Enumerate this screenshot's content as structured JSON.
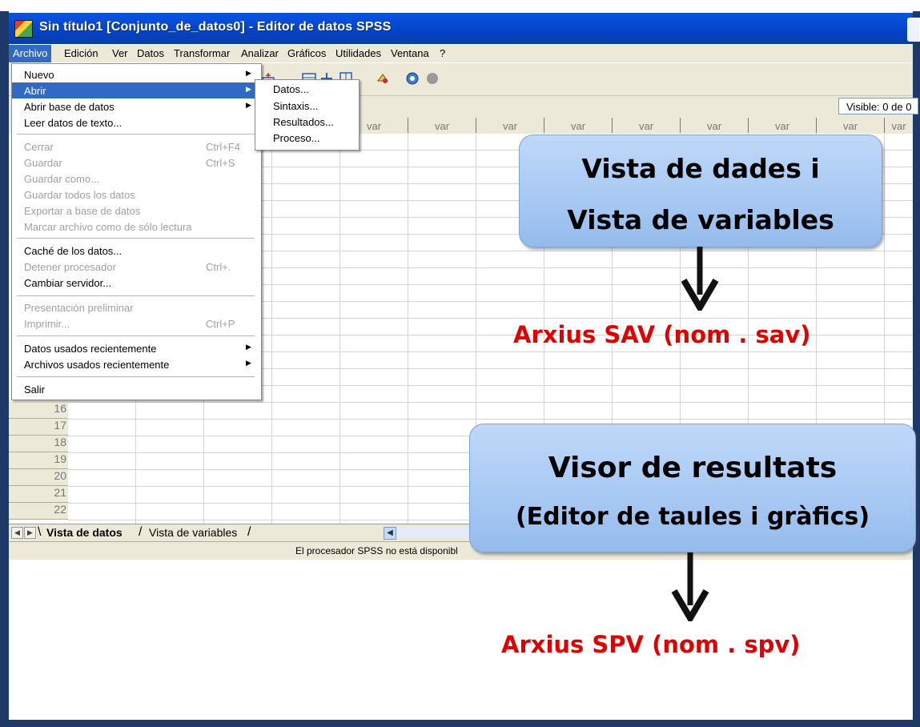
{
  "window": {
    "title": "Sin título1 [Conjunto_de_datos0] - Editor de datos SPSS"
  },
  "menubar": {
    "items": [
      "Archivo",
      "Edición",
      "Ver",
      "Datos",
      "Transformar",
      "Analizar",
      "Gráficos",
      "Utilidades",
      "Ventana",
      "?"
    ]
  },
  "cellbar": {
    "visible_text": "Visible: 0 de 0"
  },
  "grid": {
    "column_header": "var",
    "row_numbers": [
      "16",
      "17",
      "18",
      "19",
      "20",
      "21",
      "22"
    ]
  },
  "file_menu": {
    "items": [
      {
        "label": "Nuevo"
      },
      {
        "label": "Abrir"
      },
      {
        "label": "Abrir base de datos"
      },
      {
        "label": "Leer datos de texto..."
      },
      {
        "label": "Cerrar",
        "shortcut": "Ctrl+F4"
      },
      {
        "label": "Guardar",
        "shortcut": "Ctrl+S"
      },
      {
        "label": "Guardar como..."
      },
      {
        "label": "Guardar todos los datos"
      },
      {
        "label": "Exportar a base de datos"
      },
      {
        "label": "Marcar archivo como de sólo lectura"
      },
      {
        "label": "Caché de los datos..."
      },
      {
        "label": "Detener procesador",
        "shortcut": "Ctrl+."
      },
      {
        "label": "Cambiar servidor..."
      },
      {
        "label": "Presentación preliminar"
      },
      {
        "label": "Imprimir...",
        "shortcut": "Ctrl+P"
      },
      {
        "label": "Datos usados recientemente"
      },
      {
        "label": "Archivos usados recientemente"
      },
      {
        "label": "Salir"
      }
    ]
  },
  "open_submenu": {
    "items": [
      "Datos...",
      "Sintaxis...",
      "Resultados...",
      "Proceso..."
    ]
  },
  "tabs": {
    "data_view": "Vista de datos",
    "variable_view": "Vista de variables"
  },
  "statusbar": {
    "text": "El procesador SPSS no está disponibl"
  },
  "annotations": {
    "callout1_line1": "Vista de dades  i",
    "callout1_line2": "Vista de variables",
    "label1": "Arxius  SAV (nom . sav)",
    "callout2_line1": "Visor de resultats",
    "callout2_line2": "(Editor de taules i gràfics)",
    "label2": "Arxius  SPV (nom . spv)"
  },
  "colors": {
    "titlebar": "#0343c8",
    "menu_highlight": "#316ac5",
    "callout_fill": "#a6c8f3",
    "label_red": "#e00000",
    "frame": "#1c3968"
  }
}
